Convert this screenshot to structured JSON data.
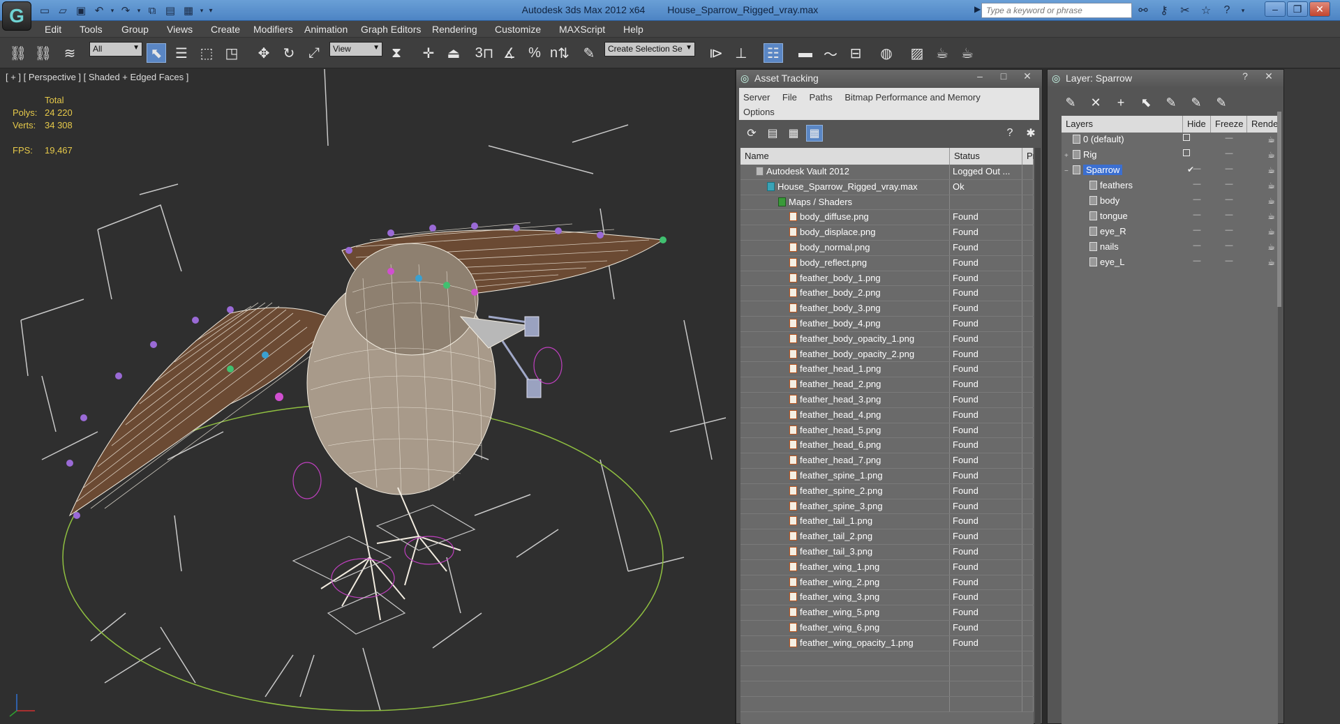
{
  "app": {
    "logo": "3ds-max-logo",
    "title": "Autodesk 3ds Max  2012 x64",
    "file": "House_Sparrow_Rigged_vray.max"
  },
  "search": {
    "placeholder": "Type a keyword or phrase"
  },
  "menu": [
    "Edit",
    "Tools",
    "Group",
    "Views",
    "Create",
    "Modifiers",
    "Animation",
    "Graph Editors",
    "Rendering",
    "Customize",
    "MAXScript",
    "Help"
  ],
  "toolbar": {
    "filter_value": "All",
    "refcoord_value": "View",
    "selection_set_placeholder": "Create Selection Se",
    "snap_labels": [
      "3",
      "%",
      "n"
    ]
  },
  "viewport": {
    "label": "[ + ] [ Perspective ] [ Shaded + Edged Faces ]",
    "stats": {
      "header": "Total",
      "polys_label": "Polys:",
      "polys": "24 220",
      "verts_label": "Verts:",
      "verts": "34 308",
      "fps_label": "FPS:",
      "fps": "19,467"
    }
  },
  "asset_tracking": {
    "title": "Asset Tracking",
    "menu": [
      "Server",
      "File",
      "Paths",
      "Bitmap Performance and Memory",
      "Options"
    ],
    "columns": {
      "name": "Name",
      "status": "Status",
      "proxy": "Pr"
    },
    "rows": [
      {
        "name": "Autodesk Vault 2012",
        "status": "Logged Out ...",
        "indent": 1,
        "kind": "vault"
      },
      {
        "name": "House_Sparrow_Rigged_vray.max",
        "status": "Ok",
        "indent": 2,
        "kind": "max"
      },
      {
        "name": "Maps / Shaders",
        "status": "",
        "indent": 3,
        "kind": "fold"
      },
      {
        "name": "body_diffuse.png",
        "status": "Found",
        "indent": 4,
        "kind": "file"
      },
      {
        "name": "body_displace.png",
        "status": "Found",
        "indent": 4,
        "kind": "file"
      },
      {
        "name": "body_normal.png",
        "status": "Found",
        "indent": 4,
        "kind": "file"
      },
      {
        "name": "body_reflect.png",
        "status": "Found",
        "indent": 4,
        "kind": "file"
      },
      {
        "name": "feather_body_1.png",
        "status": "Found",
        "indent": 4,
        "kind": "file"
      },
      {
        "name": "feather_body_2.png",
        "status": "Found",
        "indent": 4,
        "kind": "file"
      },
      {
        "name": "feather_body_3.png",
        "status": "Found",
        "indent": 4,
        "kind": "file"
      },
      {
        "name": "feather_body_4.png",
        "status": "Found",
        "indent": 4,
        "kind": "file"
      },
      {
        "name": "feather_body_opacity_1.png",
        "status": "Found",
        "indent": 4,
        "kind": "file"
      },
      {
        "name": "feather_body_opacity_2.png",
        "status": "Found",
        "indent": 4,
        "kind": "file"
      },
      {
        "name": "feather_head_1.png",
        "status": "Found",
        "indent": 4,
        "kind": "file"
      },
      {
        "name": "feather_head_2.png",
        "status": "Found",
        "indent": 4,
        "kind": "file"
      },
      {
        "name": "feather_head_3.png",
        "status": "Found",
        "indent": 4,
        "kind": "file"
      },
      {
        "name": "feather_head_4.png",
        "status": "Found",
        "indent": 4,
        "kind": "file"
      },
      {
        "name": "feather_head_5.png",
        "status": "Found",
        "indent": 4,
        "kind": "file"
      },
      {
        "name": "feather_head_6.png",
        "status": "Found",
        "indent": 4,
        "kind": "file"
      },
      {
        "name": "feather_head_7.png",
        "status": "Found",
        "indent": 4,
        "kind": "file"
      },
      {
        "name": "feather_spine_1.png",
        "status": "Found",
        "indent": 4,
        "kind": "file"
      },
      {
        "name": "feather_spine_2.png",
        "status": "Found",
        "indent": 4,
        "kind": "file"
      },
      {
        "name": "feather_spine_3.png",
        "status": "Found",
        "indent": 4,
        "kind": "file"
      },
      {
        "name": "feather_tail_1.png",
        "status": "Found",
        "indent": 4,
        "kind": "file"
      },
      {
        "name": "feather_tail_2.png",
        "status": "Found",
        "indent": 4,
        "kind": "file"
      },
      {
        "name": "feather_tail_3.png",
        "status": "Found",
        "indent": 4,
        "kind": "file"
      },
      {
        "name": "feather_wing_1.png",
        "status": "Found",
        "indent": 4,
        "kind": "file"
      },
      {
        "name": "feather_wing_2.png",
        "status": "Found",
        "indent": 4,
        "kind": "file"
      },
      {
        "name": "feather_wing_3.png",
        "status": "Found",
        "indent": 4,
        "kind": "file"
      },
      {
        "name": "feather_wing_5.png",
        "status": "Found",
        "indent": 4,
        "kind": "file"
      },
      {
        "name": "feather_wing_6.png",
        "status": "Found",
        "indent": 4,
        "kind": "file"
      },
      {
        "name": "feather_wing_opacity_1.png",
        "status": "Found",
        "indent": 4,
        "kind": "file"
      }
    ]
  },
  "layer_panel": {
    "title": "Layer: Sparrow",
    "columns": {
      "layers": "Layers",
      "hide": "Hide",
      "freeze": "Freeze",
      "render": "Rende"
    },
    "rows": [
      {
        "name": "0 (default)",
        "level": 0,
        "expander": "",
        "selected": false,
        "hide_box": true
      },
      {
        "name": "Rig",
        "level": 0,
        "expander": "+",
        "selected": false,
        "hide_box": true
      },
      {
        "name": "Sparrow",
        "level": 0,
        "expander": "−",
        "selected": true,
        "hide_box": false,
        "current": true
      },
      {
        "name": "feathers",
        "level": 1,
        "expander": "",
        "selected": false,
        "hide_box": false
      },
      {
        "name": "body",
        "level": 1,
        "expander": "",
        "selected": false,
        "hide_box": false
      },
      {
        "name": "tongue",
        "level": 1,
        "expander": "",
        "selected": false,
        "hide_box": false
      },
      {
        "name": "eye_R",
        "level": 1,
        "expander": "",
        "selected": false,
        "hide_box": false
      },
      {
        "name": "nails",
        "level": 1,
        "expander": "",
        "selected": false,
        "hide_box": false
      },
      {
        "name": "eye_L",
        "level": 1,
        "expander": "",
        "selected": false,
        "hide_box": false
      }
    ]
  },
  "colors": {
    "titlebar": "#5a90cc",
    "selection": "#3b6fd1",
    "stats": "#e6c94a",
    "wire": "#f2ece0",
    "feather": "#6b4a33",
    "ground_circle": "#8fbf40",
    "helper": "#c9c9c9"
  }
}
